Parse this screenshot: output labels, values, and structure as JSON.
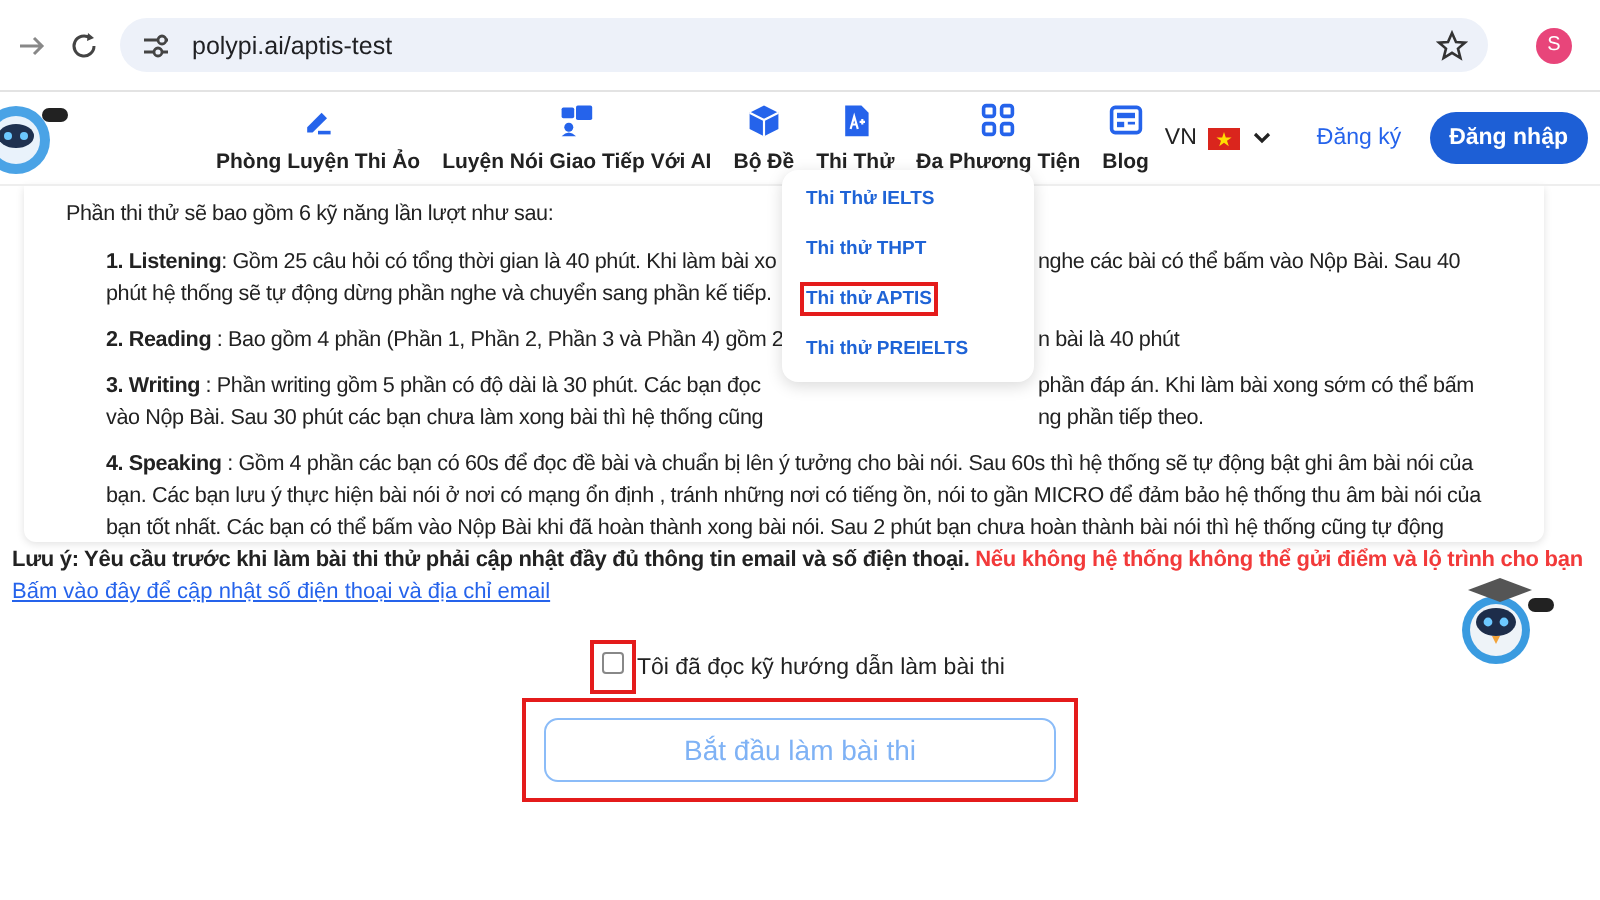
{
  "browser": {
    "url": "polypi.ai/aptis-test",
    "avatar": "S"
  },
  "nav": {
    "items": [
      {
        "label": "Phòng Luyện Thi Ảo",
        "kind": "pencil"
      },
      {
        "label": "Luyện Nói Giao Tiếp Với AI",
        "kind": "chat"
      },
      {
        "label": "Bộ Đề",
        "kind": "box"
      },
      {
        "label": "Thi Thử",
        "kind": "doc"
      },
      {
        "label": "Đa Phương Tiện",
        "kind": "grid"
      },
      {
        "label": "Blog",
        "kind": "news"
      }
    ],
    "language": "VN",
    "register": "Đăng ký",
    "login": "Đăng nhập"
  },
  "dropdown": [
    {
      "label": "Thi Thử IELTS",
      "highlighted": false
    },
    {
      "label": "Thi thử THPT",
      "highlighted": false
    },
    {
      "label": "Thi thử APTIS",
      "highlighted": true
    },
    {
      "label": "Thi thử PREIELTS",
      "highlighted": false
    }
  ],
  "intro": "Phần thi thử sẽ bao gồm 6 kỹ năng lần lượt như sau:",
  "paragraphs": [
    {
      "lines": [
        {
          "text": "**1. Listening**: Gồm 25 câu hỏi có tổng thời gian là 40 phút. Khi làm bài xo",
          "after_menu": "nghe các bài có thể bấm vào Nộp Bài. Sau 40"
        },
        {
          "text": "phút hệ thống sẽ tự động dừng phần nghe và chuyển sang phần kế tiếp."
        }
      ]
    },
    {
      "lines": [
        {
          "text": "**2. Reading** : Bao gồm 4 phần (Phần 1, Phần 2, Phần 3 và Phần 4) gồm 2",
          "after_menu": "n bài là 40 phút"
        }
      ]
    },
    {
      "lines": [
        {
          "text": "**3. Writing** : Phần writing gồm 5 phần có độ dài là 30 phút. Các bạn đọc",
          "after_menu": "phần đáp án. Khi làm bài xong sớm có thể bấm"
        },
        {
          "text": "vào Nộp Bài. Sau 30 phút các bạn chưa làm xong bài thì hệ thống cũng",
          "after_menu": "ng phần tiếp theo."
        }
      ]
    },
    {
      "lines": [
        {
          "text": "**4. Speaking** : Gồm 4 phần các bạn có 60s để đọc đề bài và chuẩn bị lên ý tưởng cho bài nói. Sau 60s thì hệ thống sẽ tự động bật ghi âm bài nói của"
        },
        {
          "text": "bạn. Các bạn lưu ý thực hiện bài nói ở nơi có mạng ổn định , tránh những nơi có tiếng ồn, nói to gần MICRO để đảm bảo hệ thống thu âm bài nói của"
        },
        {
          "text": "bạn tốt nhất. Các bạn có thể bấm vào Nộp Bài khi đã hoàn thành xong bài nói. Sau 2 phút bạn chưa hoàn thành bài nói thì hệ thống cũng tự động"
        }
      ]
    }
  ],
  "notice": {
    "text": "Lưu ý: Yêu cầu trước khi làm bài thi thử phải cập nhật đầy đủ thông tin email và số điện thoại.",
    "warning": "Nếu không hệ thống không thể gửi điểm và lộ trình cho bạn"
  },
  "update_link": "Bấm vào đây để cập nhật số điện thoại và địa chỉ email",
  "agreement": {
    "label": "Tôi đã đọc kỹ hướng dẫn làm bài thi",
    "checked": false,
    "highlighted": true
  },
  "start_button": {
    "label": "Bắt đầu làm bài thi",
    "disabled": true,
    "highlighted": true
  }
}
